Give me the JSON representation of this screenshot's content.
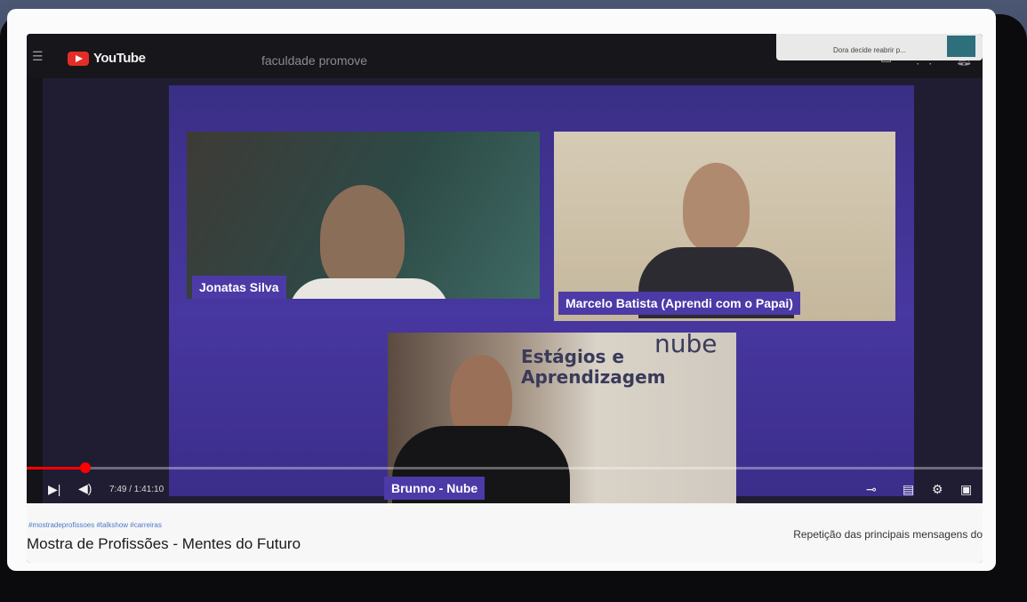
{
  "youtube": {
    "brand": "YouTube",
    "search_text": "faculdade promove",
    "notification": "Dora decide reabrir p..."
  },
  "participants": [
    {
      "name": "Jonatas Silva"
    },
    {
      "name": "Marcelo Batista (Aprendi com o Papai)"
    },
    {
      "name": "Brunno - Nube"
    }
  ],
  "banner": {
    "line1": "Estágios e",
    "line2": "Aprendizagem",
    "brand": "nube"
  },
  "player": {
    "time": "7:49 / 1:41:10",
    "progress": 0.0617
  },
  "video": {
    "hashtags": "#mostradeprofissoes #talkshow #carreiras",
    "title": "Mostra de Profissões - Mentes do Futuro",
    "next": "Repetição das principais mensagens do"
  },
  "colors": {
    "accent": "#ff0000",
    "nametag": "#4c3aa7",
    "background": "#3b2d8a"
  }
}
